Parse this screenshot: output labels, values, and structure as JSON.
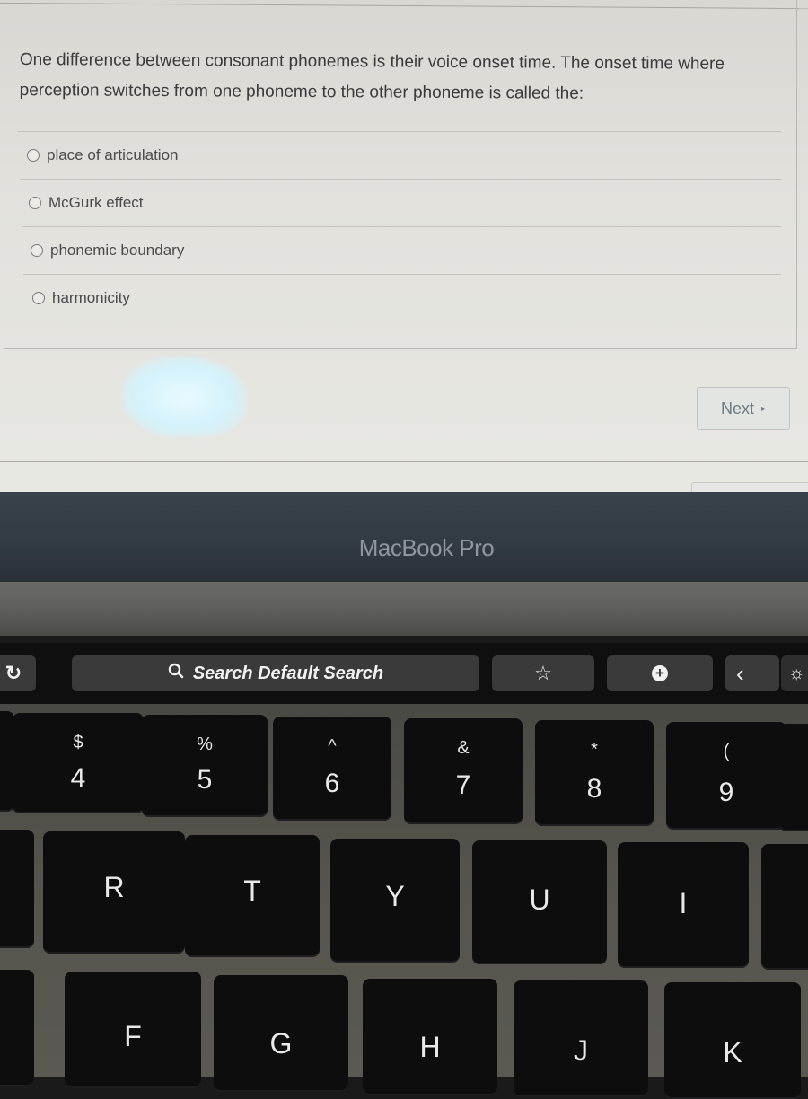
{
  "quiz": {
    "question": "One difference between consonant phonemes is their voice onset time. The onset time where perception switches from one phoneme to the other phoneme is called the:",
    "answers": [
      {
        "label": "place of articulation",
        "selected": false
      },
      {
        "label": "McGurk effect",
        "selected": false
      },
      {
        "label": "phonemic boundary",
        "selected": false
      },
      {
        "label": "harmonicity",
        "selected": false
      }
    ],
    "next_label": "Next",
    "next_icon": "▸"
  },
  "bezel": {
    "logo_text": "MacBook Pro"
  },
  "touchbar": {
    "reload_icon": "↻",
    "search_icon": "🔍",
    "search_label": "Search Default Search",
    "bookmark_icon": "☆",
    "new_tab_icon": "+",
    "back_icon": "‹",
    "brightness_icon": "☼"
  },
  "keyboard": {
    "number_row": [
      {
        "symbol": "$",
        "number": "4"
      },
      {
        "symbol": "%",
        "number": "5"
      },
      {
        "symbol": "^",
        "number": "6"
      },
      {
        "symbol": "&",
        "number": "7"
      },
      {
        "symbol": "*",
        "number": "8"
      },
      {
        "symbol": "(",
        "number": "9"
      }
    ],
    "top_letter_row": [
      "R",
      "T",
      "Y",
      "U",
      "I"
    ],
    "home_letter_row": [
      "F",
      "G",
      "H",
      "J",
      "K"
    ]
  }
}
